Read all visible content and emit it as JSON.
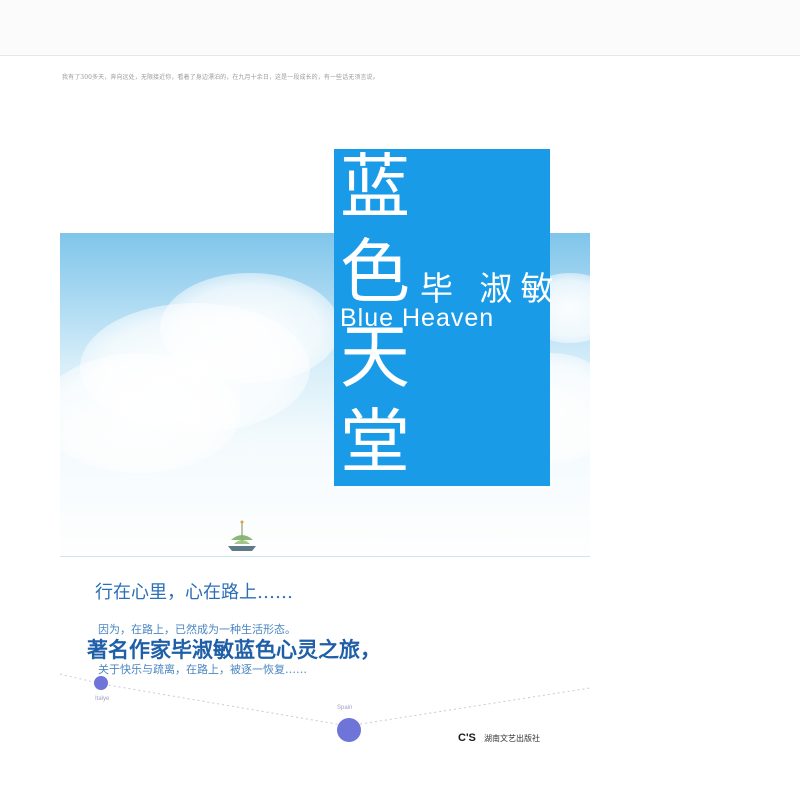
{
  "blurb": "我有了300多天，奔向远处，无限接近你，看着了身边漂泊的，在九月十余日，这是一段成长的，有一些话无须言说。",
  "cover": {
    "title_chars": [
      "蓝",
      "色",
      "天",
      "堂"
    ],
    "author": "毕 淑敏",
    "english_title": "Blue Heaven",
    "tagline": "行在心里，心在路上……",
    "line1": "因为，在路上，已然成为一种生活形态。",
    "headline": "著名作家毕淑敏蓝色心灵之旅，",
    "line2": "关于快乐与疏离，在路上，被逐一恢复……",
    "places": [
      "Italye",
      "Spain"
    ],
    "publisher_logo": "C'S",
    "publisher_name": "湖南文艺出版社"
  },
  "colors": {
    "title_panel": "#1a9be8",
    "tagline": "#2c6fb7",
    "dots": "#6f74d8"
  }
}
